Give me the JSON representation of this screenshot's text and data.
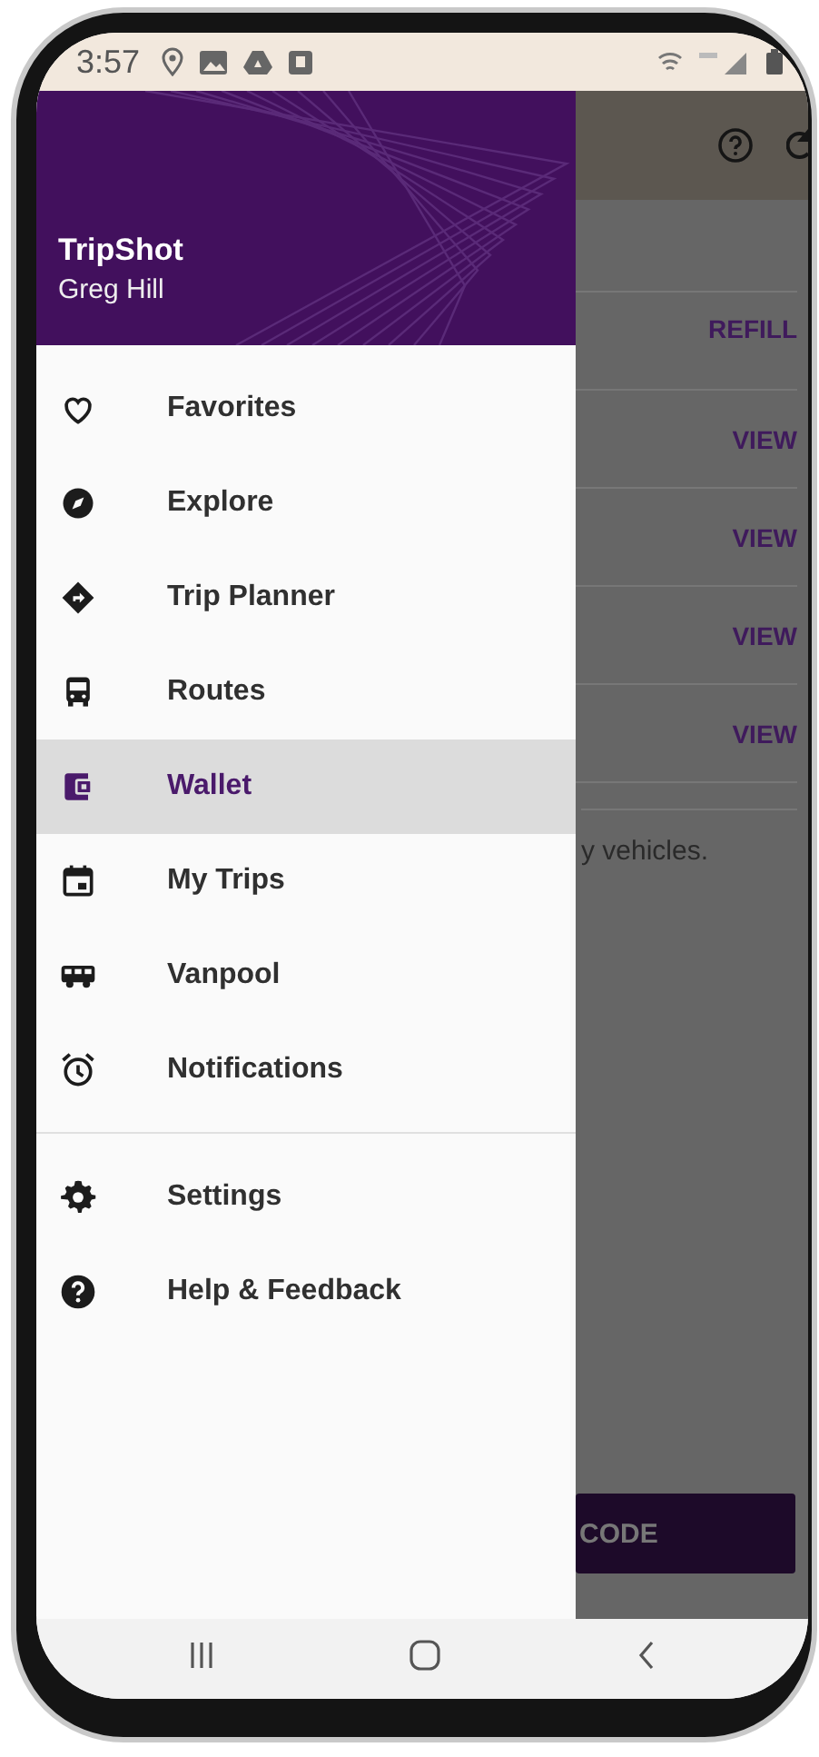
{
  "status_bar": {
    "time": "3:57"
  },
  "app": {
    "actions": [
      {
        "label": "REFILL"
      },
      {
        "label": "VIEW"
      },
      {
        "label": "VIEW"
      },
      {
        "label": "VIEW"
      },
      {
        "label": "VIEW"
      }
    ],
    "note": "y vehicles.",
    "button": "CODE"
  },
  "drawer": {
    "title": "TripShot",
    "subtitle": "Greg Hill",
    "items": [
      {
        "label": "Favorites",
        "selected": false
      },
      {
        "label": "Explore",
        "selected": false
      },
      {
        "label": "Trip Planner",
        "selected": false
      },
      {
        "label": "Routes",
        "selected": false
      },
      {
        "label": "Wallet",
        "selected": true
      },
      {
        "label": "My Trips",
        "selected": false
      },
      {
        "label": "Vanpool",
        "selected": false
      },
      {
        "label": "Notifications",
        "selected": false
      }
    ],
    "secondary_items": [
      {
        "label": "Settings",
        "selected": false
      },
      {
        "label": "Help & Feedback",
        "selected": false
      }
    ]
  }
}
